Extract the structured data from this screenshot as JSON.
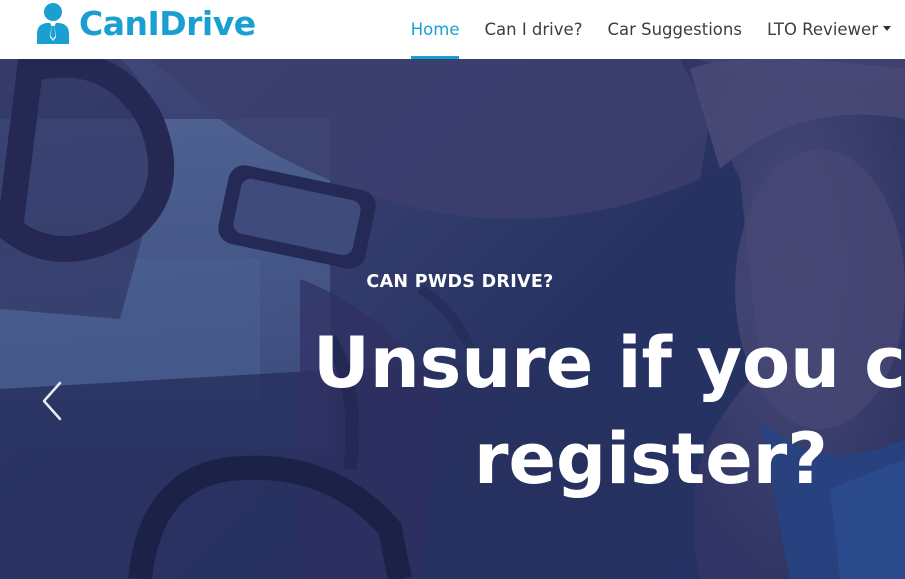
{
  "brand": {
    "name": "CanIDrive",
    "icon": "user-tie-icon",
    "color": "#1a9fd3"
  },
  "nav": {
    "items": [
      {
        "label": "Home",
        "active": true
      },
      {
        "label": "Can I drive?",
        "active": false
      },
      {
        "label": "Car Suggestions",
        "active": false
      },
      {
        "label": "LTO Reviewer",
        "active": false,
        "dropdown": true
      }
    ],
    "active_color": "#1a9fd3"
  },
  "hero": {
    "subtitle": "CAN PWDS DRIVE?",
    "title_line1": "Unsure if you ca",
    "title_line2": "register?",
    "prev_icon": "chevron-left-icon"
  }
}
